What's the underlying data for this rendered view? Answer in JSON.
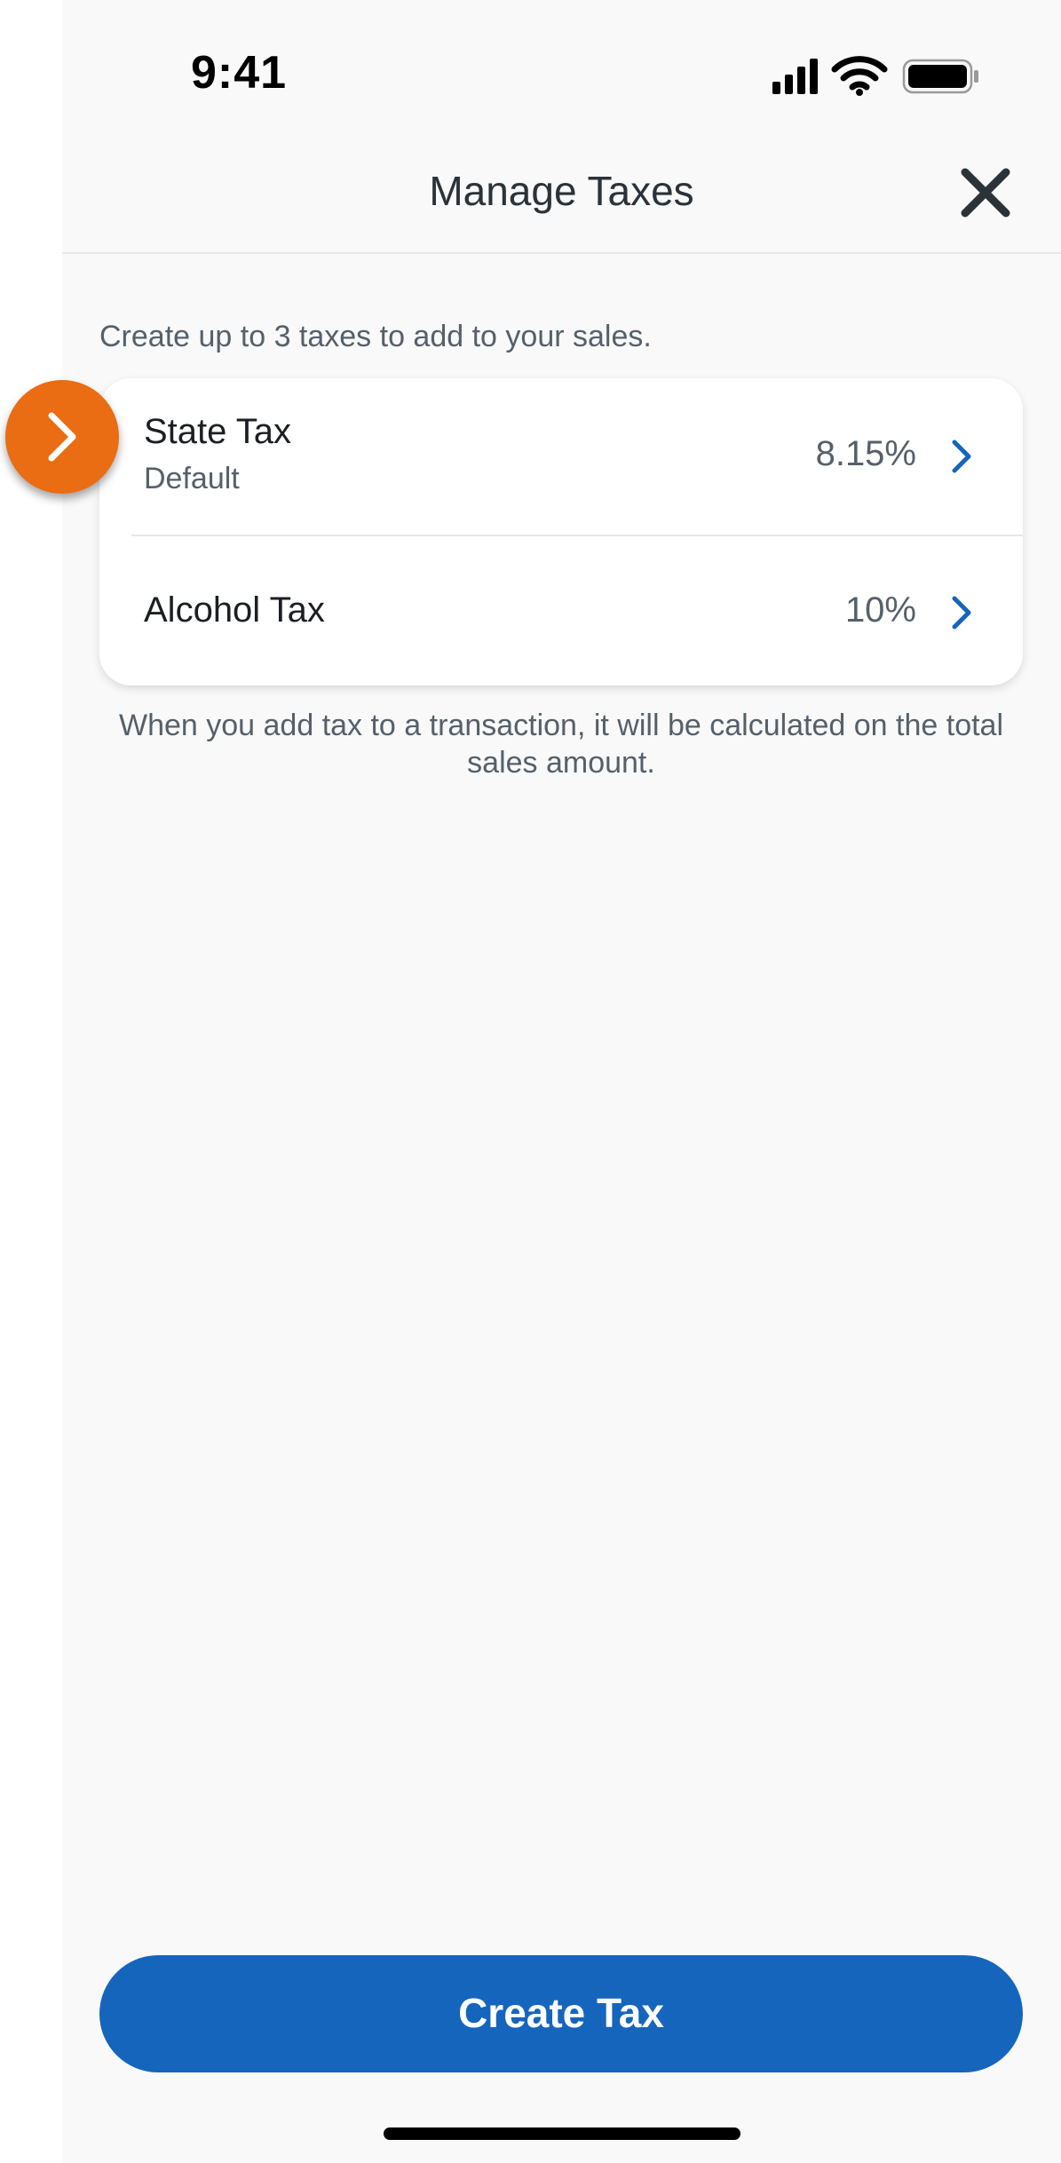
{
  "status_bar": {
    "time": "9:41",
    "icons": [
      "cellular-signal-icon",
      "wifi-icon",
      "battery-icon"
    ]
  },
  "header": {
    "title": "Manage Taxes",
    "close_icon": "close-icon"
  },
  "intro": "Create up to 3 taxes to add to your sales.",
  "taxes": [
    {
      "name": "State Tax",
      "subtitle": "Default",
      "rate": "8.15%"
    },
    {
      "name": "Alcohol Tax",
      "rate": "10%"
    }
  ],
  "footnote": "When you add tax to a transaction, it will be calculated on the total sales amount.",
  "primary_button": {
    "label": "Create Tax"
  },
  "hint_marker_icon": "chevron-right-icon",
  "colors": {
    "accent": "#1565bd",
    "hint": "#ea6c13",
    "background": "#f9f9f9",
    "card": "#ffffff",
    "text_primary": "#1b1f23",
    "text_secondary": "#56606a"
  }
}
